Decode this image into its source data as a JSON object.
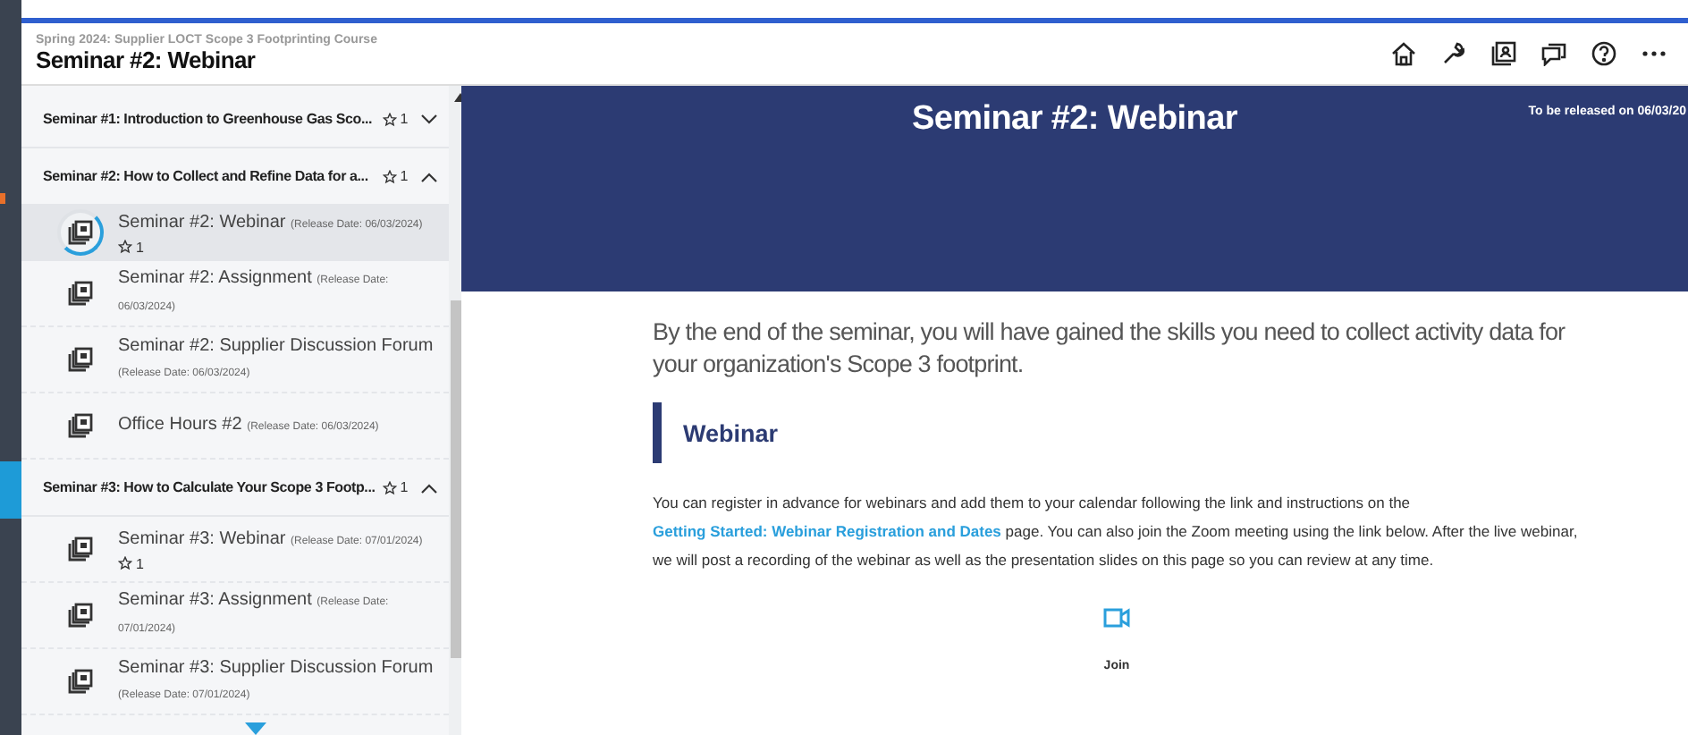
{
  "header": {
    "course": "Spring 2024: Supplier LOCT Scope 3 Footprinting Course",
    "title": "Seminar #2: Webinar"
  },
  "sidebar": {
    "sections": [
      {
        "title": "Seminar #1: Introduction to Greenhouse Gas Sco...",
        "count": "1",
        "expanded": false
      },
      {
        "title": "Seminar #2: How to Collect and Refine Data for a...",
        "count": "1",
        "expanded": true,
        "items": [
          {
            "title": "Seminar #2: Webinar",
            "release": "(Release Date: 06/03/2024)",
            "count": "1",
            "selected": true
          },
          {
            "title": "Seminar #2: Assignment",
            "release": "(Release Date: 06/03/2024)",
            "selected": false
          },
          {
            "title": "Seminar #2: Supplier Discussion Forum",
            "release": "(Release Date: 06/03/2024)",
            "selected": false
          },
          {
            "title": "Office Hours #2",
            "release": "(Release Date: 06/03/2024)",
            "selected": false
          }
        ]
      },
      {
        "title": "Seminar #3: How to Calculate Your Scope 3 Footp...",
        "count": "1",
        "expanded": true,
        "items": [
          {
            "title": "Seminar #3: Webinar",
            "release": "(Release Date: 07/01/2024)",
            "count": "1",
            "selected": false
          },
          {
            "title": "Seminar #3: Assignment",
            "release": "(Release Date: 07/01/2024)",
            "selected": false
          },
          {
            "title": "Seminar #3: Supplier Discussion Forum",
            "release": "(Release Date: 07/01/2024)",
            "selected": false
          }
        ]
      }
    ]
  },
  "banner": {
    "title": "Seminar #2: Webinar",
    "release_note": "To be released on 06/03/20"
  },
  "content": {
    "intro": "By the end of the seminar, you will have gained the skills you need to collect activity data for your organization's Scope 3 footprint.",
    "heading": "Webinar",
    "paragraph": {
      "before": "You can register in advance for webinars and add them to your calendar following the link and instructions on the",
      "link": "Getting Started: Webinar Registration and Dates",
      "after": "page. You can also join the Zoom meeting using the link below. After the live webinar, we will post a recording of the webinar as well as the presentation slides on this page so you can review at any time."
    },
    "join": "Join"
  }
}
